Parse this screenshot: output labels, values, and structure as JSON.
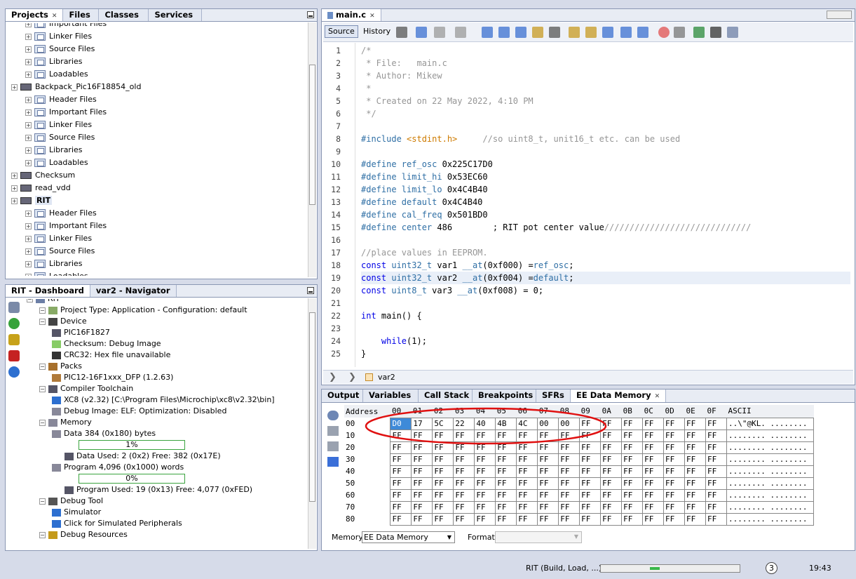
{
  "projects_panel": {
    "tabs": [
      "Projects",
      "Files",
      "Classes",
      "Services"
    ],
    "rows": [
      {
        "label": "Important Files",
        "level": 2,
        "icon": "folder"
      },
      {
        "label": "Linker Files",
        "level": 2,
        "icon": "folder"
      },
      {
        "label": "Source Files",
        "level": 2,
        "icon": "folder"
      },
      {
        "label": "Libraries",
        "level": 2,
        "icon": "folder"
      },
      {
        "label": "Loadables",
        "level": 2,
        "icon": "folder"
      },
      {
        "label": "Backpack_Pic16F18854_old",
        "level": 1,
        "icon": "chip"
      },
      {
        "label": "Header Files",
        "level": 2,
        "icon": "folder"
      },
      {
        "label": "Important Files",
        "level": 2,
        "icon": "folder"
      },
      {
        "label": "Linker Files",
        "level": 2,
        "icon": "folder"
      },
      {
        "label": "Source Files",
        "level": 2,
        "icon": "folder"
      },
      {
        "label": "Libraries",
        "level": 2,
        "icon": "folder"
      },
      {
        "label": "Loadables",
        "level": 2,
        "icon": "folder"
      },
      {
        "label": "Checksum",
        "level": 1,
        "icon": "chip"
      },
      {
        "label": "read_vdd",
        "level": 1,
        "icon": "chip"
      },
      {
        "label": "RIT",
        "level": 1,
        "icon": "chip"
      },
      {
        "label": "Header Files",
        "level": 2,
        "icon": "folder"
      },
      {
        "label": "Important Files",
        "level": 2,
        "icon": "folder"
      },
      {
        "label": "Linker Files",
        "level": 2,
        "icon": "folder"
      },
      {
        "label": "Source Files",
        "level": 2,
        "icon": "folder"
      },
      {
        "label": "Libraries",
        "level": 2,
        "icon": "folder"
      },
      {
        "label": "Loadables",
        "level": 2,
        "icon": "folder"
      }
    ]
  },
  "dashboard": {
    "tabs": [
      "RIT - Dashboard",
      "var2 - Navigator"
    ],
    "rows": [
      {
        "label": "RIT",
        "level": 0
      },
      {
        "label": "Project Type: Application - Configuration: default",
        "level": 1
      },
      {
        "label": "Device",
        "level": 1
      },
      {
        "label": "PIC16F1827",
        "level": 2
      },
      {
        "label": "Checksum: Debug Image",
        "level": 2
      },
      {
        "label": "CRC32: Hex file unavailable",
        "level": 2
      },
      {
        "label": "Packs",
        "level": 1
      },
      {
        "label": "PIC12-16F1xxx_DFP (1.2.63)",
        "level": 2
      },
      {
        "label": "Compiler Toolchain",
        "level": 1
      },
      {
        "label": "XC8 (v2.32) [C:\\Program Files\\Microchip\\xc8\\v2.32\\bin]",
        "level": 2
      },
      {
        "label": "Debug Image: ELF: Optimization: Disabled",
        "level": 2
      },
      {
        "label": "Memory",
        "level": 1
      },
      {
        "label": "Data 384 (0x180) bytes",
        "level": 2
      },
      {
        "label": "",
        "level": 3,
        "bar": "1%"
      },
      {
        "label": "Data Used: 2 (0x2) Free: 382 (0x17E)",
        "level": 3
      },
      {
        "label": "Program 4,096 (0x1000) words",
        "level": 2
      },
      {
        "label": "",
        "level": 3,
        "bar": "0%"
      },
      {
        "label": "Program Used: 19 (0x13) Free: 4,077 (0xFED)",
        "level": 3
      },
      {
        "label": "Debug Tool",
        "level": 1
      },
      {
        "label": "Simulator",
        "level": 2
      },
      {
        "label": "Click for Simulated Peripherals",
        "level": 2
      },
      {
        "label": "Debug Resources",
        "level": 1
      }
    ]
  },
  "editor": {
    "tab": "main.c",
    "toolbar": {
      "source": "Source",
      "history": "History"
    },
    "lines": [
      [
        [
          "cm",
          "/*"
        ]
      ],
      [
        [
          "cm",
          " * File:   main.c"
        ]
      ],
      [
        [
          "cm",
          " * Author: Mikew"
        ]
      ],
      [
        [
          "cm",
          " *"
        ]
      ],
      [
        [
          "cm",
          " * Created on 22 May 2022, 4:10 PM"
        ]
      ],
      [
        [
          "cm",
          " */"
        ]
      ],
      [],
      [
        [
          "mac",
          "#include "
        ],
        [
          "str",
          "<stdint.h>"
        ],
        [
          "cm",
          "     //so uint8_t, unit16_t etc. can be used"
        ]
      ],
      [],
      [
        [
          "mac",
          "#define "
        ],
        [
          "mac",
          "ref_osc"
        ],
        [
          "num",
          " 0x225C17D0"
        ]
      ],
      [
        [
          "mac",
          "#define "
        ],
        [
          "mac",
          "limit_hi"
        ],
        [
          "num",
          " 0x53EC60"
        ]
      ],
      [
        [
          "mac",
          "#define "
        ],
        [
          "mac",
          "limit_lo"
        ],
        [
          "num",
          " 0x4C4B40"
        ]
      ],
      [
        [
          "mac",
          "#define "
        ],
        [
          "mac",
          "default"
        ],
        [
          "num",
          " 0x4C4B40"
        ]
      ],
      [
        [
          "mac",
          "#define "
        ],
        [
          "mac",
          "cal_freq"
        ],
        [
          "num",
          " 0x501BD0"
        ]
      ],
      [
        [
          "mac",
          "#define "
        ],
        [
          "mac",
          "center"
        ],
        [
          "num",
          " 486        ; RIT pot center value"
        ],
        [
          "cm",
          "/////////////////////////////"
        ]
      ],
      [],
      [
        [
          "cm",
          "//place values in EEPROM."
        ]
      ],
      [
        [
          "kw",
          "const "
        ],
        [
          "mac",
          "uint32_t"
        ],
        [
          "num",
          " var1 "
        ],
        [
          "mac",
          "__at"
        ],
        [
          "num",
          "(0xf000) ="
        ],
        [
          "mac",
          "ref_osc"
        ],
        [
          "num",
          ";"
        ]
      ],
      [
        [
          "kw",
          "const "
        ],
        [
          "mac",
          "uint32_t"
        ],
        [
          "num",
          " var2 "
        ],
        [
          "mac",
          "__at"
        ],
        [
          "num",
          "(0xf004) ="
        ],
        [
          "mac",
          "default"
        ],
        [
          "num",
          ";"
        ]
      ],
      [
        [
          "kw",
          "const "
        ],
        [
          "mac",
          "uint8_t"
        ],
        [
          "num",
          " var3 "
        ],
        [
          "mac",
          "__at"
        ],
        [
          "num",
          "(0xf008) = 0;"
        ]
      ],
      [],
      [
        [
          "kw",
          "int "
        ],
        [
          "num",
          "main() {"
        ]
      ],
      [],
      [
        [
          "num",
          "    "
        ],
        [
          "kw",
          "while"
        ],
        [
          "num",
          "(1);"
        ]
      ],
      [
        [
          "num",
          "}"
        ]
      ]
    ],
    "breadcrumb": "var2"
  },
  "memory": {
    "tabs": [
      "Output",
      "Variables",
      "Call Stack",
      "Breakpoints",
      "SFRs",
      "EE Data Memory"
    ],
    "header": [
      "Address",
      "00",
      "01",
      "02",
      "03",
      "04",
      "05",
      "06",
      "07",
      "08",
      "09",
      "0A",
      "0B",
      "0C",
      "0D",
      "0E",
      "0F",
      "ASCII"
    ],
    "rows": [
      {
        "addr": "00",
        "cells": [
          "D0",
          "17",
          "5C",
          "22",
          "40",
          "4B",
          "4C",
          "00",
          "00",
          "FF",
          "FF",
          "FF",
          "FF",
          "FF",
          "FF",
          "FF"
        ],
        "ascii": "..\\\"@KL. ........"
      },
      {
        "addr": "10",
        "cells": [
          "FF",
          "FF",
          "FF",
          "FF",
          "FF",
          "FF",
          "FF",
          "FF",
          "FF",
          "FF",
          "FF",
          "FF",
          "FF",
          "FF",
          "FF",
          "FF"
        ],
        "ascii": "........ ........"
      },
      {
        "addr": "20",
        "cells": [
          "FF",
          "FF",
          "FF",
          "FF",
          "FF",
          "FF",
          "FF",
          "FF",
          "FF",
          "FF",
          "FF",
          "FF",
          "FF",
          "FF",
          "FF",
          "FF"
        ],
        "ascii": "........ ........"
      },
      {
        "addr": "30",
        "cells": [
          "FF",
          "FF",
          "FF",
          "FF",
          "FF",
          "FF",
          "FF",
          "FF",
          "FF",
          "FF",
          "FF",
          "FF",
          "FF",
          "FF",
          "FF",
          "FF"
        ],
        "ascii": "........ ........"
      },
      {
        "addr": "40",
        "cells": [
          "FF",
          "FF",
          "FF",
          "FF",
          "FF",
          "FF",
          "FF",
          "FF",
          "FF",
          "FF",
          "FF",
          "FF",
          "FF",
          "FF",
          "FF",
          "FF"
        ],
        "ascii": "........ ........"
      },
      {
        "addr": "50",
        "cells": [
          "FF",
          "FF",
          "FF",
          "FF",
          "FF",
          "FF",
          "FF",
          "FF",
          "FF",
          "FF",
          "FF",
          "FF",
          "FF",
          "FF",
          "FF",
          "FF"
        ],
        "ascii": "........ ........"
      },
      {
        "addr": "60",
        "cells": [
          "FF",
          "FF",
          "FF",
          "FF",
          "FF",
          "FF",
          "FF",
          "FF",
          "FF",
          "FF",
          "FF",
          "FF",
          "FF",
          "FF",
          "FF",
          "FF"
        ],
        "ascii": "........ ........"
      },
      {
        "addr": "70",
        "cells": [
          "FF",
          "FF",
          "FF",
          "FF",
          "FF",
          "FF",
          "FF",
          "FF",
          "FF",
          "FF",
          "FF",
          "FF",
          "FF",
          "FF",
          "FF",
          "FF"
        ],
        "ascii": "........ ........"
      },
      {
        "addr": "80",
        "cells": [
          "FF",
          "FF",
          "FF",
          "FF",
          "FF",
          "FF",
          "FF",
          "FF",
          "FF",
          "FF",
          "FF",
          "FF",
          "FF",
          "FF",
          "FF",
          "FF"
        ],
        "ascii": "........ ........"
      }
    ],
    "memory_label": "Memory",
    "memory_value": "EE Data Memory",
    "format_label": "Format"
  },
  "status": {
    "task": "RIT (Build, Load, ...)",
    "badge": "3",
    "time": "19:43"
  },
  "colors": {
    "accent": "#3e8ad8",
    "annotation": "#e01010"
  }
}
